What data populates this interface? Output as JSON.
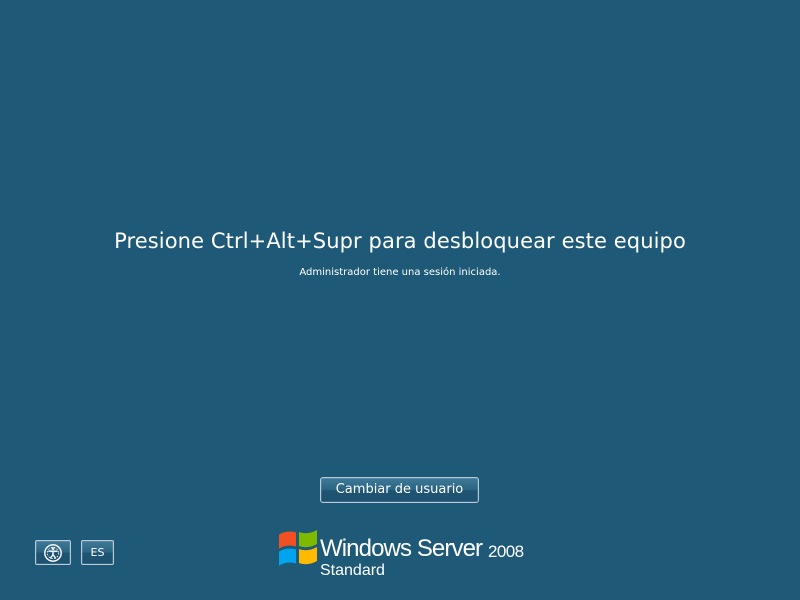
{
  "lock_screen": {
    "instruction": "Presione Ctrl+Alt+Supr para desbloquear este equipo",
    "session_info": "Administrador tiene una sesión iniciada."
  },
  "buttons": {
    "switch_user": "Cambiar de usuario",
    "ease_of_access_icon": "ease-of-access-icon",
    "language": "ES"
  },
  "branding": {
    "logo_icon": "windows-flag-icon",
    "product_name": "Windows Server",
    "version": "2008",
    "edition": "Standard"
  },
  "colors": {
    "background": "#1e5a78",
    "text": "#ffffff",
    "button_border": "#b9cbd7"
  }
}
